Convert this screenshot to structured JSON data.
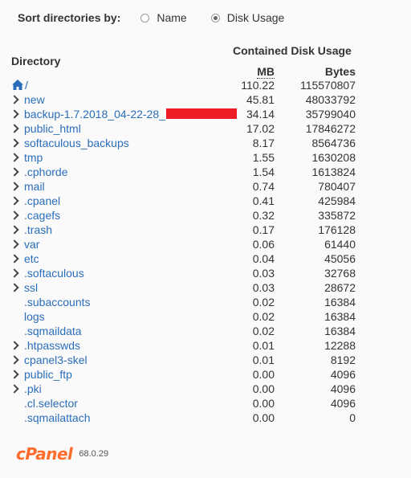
{
  "sort": {
    "label": "Sort directories by:",
    "options": [
      {
        "label": "Name",
        "checked": false
      },
      {
        "label": "Disk Usage",
        "checked": true
      }
    ]
  },
  "headers": {
    "directory": "Directory",
    "contained": "Contained Disk Usage",
    "mb": "MB",
    "bytes": "Bytes"
  },
  "root": {
    "name": "/",
    "mb": "110.22",
    "bytes": "115570807"
  },
  "directories": [
    {
      "name": "new",
      "mb": "45.81",
      "bytes": "48033792",
      "expandable": true
    },
    {
      "name": "backup-1.7.2018_04-22-28_",
      "mb": "34.14",
      "bytes": "35799040",
      "expandable": true,
      "redacted": true
    },
    {
      "name": "public_html",
      "mb": "17.02",
      "bytes": "17846272",
      "expandable": true
    },
    {
      "name": "softaculous_backups",
      "mb": "8.17",
      "bytes": "8564736",
      "expandable": true
    },
    {
      "name": "tmp",
      "mb": "1.55",
      "bytes": "1630208",
      "expandable": true
    },
    {
      "name": ".cphorde",
      "mb": "1.54",
      "bytes": "1613824",
      "expandable": true
    },
    {
      "name": "mail",
      "mb": "0.74",
      "bytes": "780407",
      "expandable": true
    },
    {
      "name": ".cpanel",
      "mb": "0.41",
      "bytes": "425984",
      "expandable": true
    },
    {
      "name": ".cagefs",
      "mb": "0.32",
      "bytes": "335872",
      "expandable": true
    },
    {
      "name": ".trash",
      "mb": "0.17",
      "bytes": "176128",
      "expandable": true
    },
    {
      "name": "var",
      "mb": "0.06",
      "bytes": "61440",
      "expandable": true
    },
    {
      "name": "etc",
      "mb": "0.04",
      "bytes": "45056",
      "expandable": true
    },
    {
      "name": ".softaculous",
      "mb": "0.03",
      "bytes": "32768",
      "expandable": true
    },
    {
      "name": "ssl",
      "mb": "0.03",
      "bytes": "28672",
      "expandable": true
    },
    {
      "name": ".subaccounts",
      "mb": "0.02",
      "bytes": "16384",
      "expandable": false
    },
    {
      "name": "logs",
      "mb": "0.02",
      "bytes": "16384",
      "expandable": false
    },
    {
      "name": ".sqmaildata",
      "mb": "0.02",
      "bytes": "16384",
      "expandable": false
    },
    {
      "name": ".htpasswds",
      "mb": "0.01",
      "bytes": "12288",
      "expandable": true
    },
    {
      "name": "cpanel3-skel",
      "mb": "0.01",
      "bytes": "8192",
      "expandable": true
    },
    {
      "name": "public_ftp",
      "mb": "0.00",
      "bytes": "4096",
      "expandable": true
    },
    {
      "name": ".pki",
      "mb": "0.00",
      "bytes": "4096",
      "expandable": true
    },
    {
      "name": ".cl.selector",
      "mb": "0.00",
      "bytes": "4096",
      "expandable": false
    },
    {
      "name": ".sqmailattach",
      "mb": "0.00",
      "bytes": "0",
      "expandable": false
    }
  ],
  "footer": {
    "logo": "cPanel",
    "version": "68.0.29"
  },
  "colors": {
    "link": "#2a6ebb",
    "logo": "#ff6c2c",
    "redaction": "#ee1c25"
  },
  "icons": {
    "home": "home-icon",
    "expand": "chevron-right-icon"
  }
}
